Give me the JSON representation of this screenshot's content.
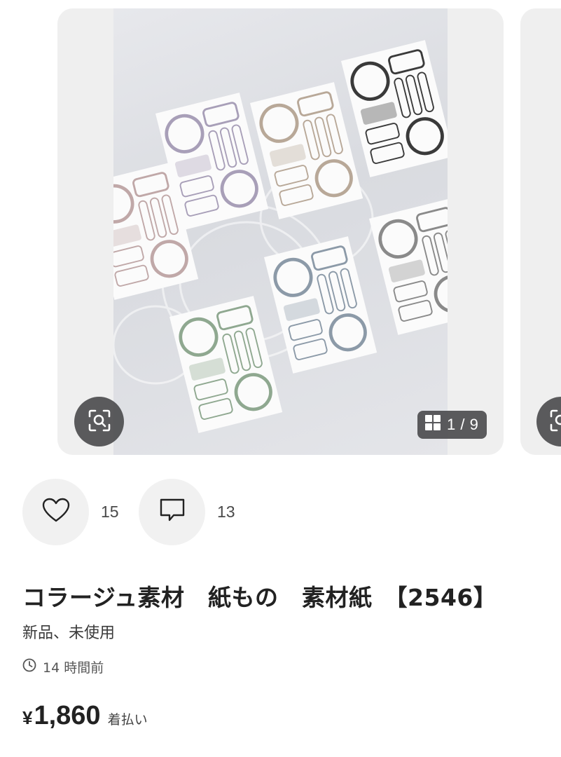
{
  "item": {
    "title": "コラージュ素材　紙もの　素材紙　【2546】",
    "condition": "新品、未使用",
    "posted_ago": "14 時間前",
    "price_currency": "¥",
    "price": "1,860",
    "shipping": "着払い"
  },
  "carousel": {
    "counter": "1 / 9"
  },
  "actions": {
    "likes": "15",
    "comments": "13"
  },
  "icons": {
    "zoom": "zoom-search-icon",
    "grid": "grid-icon",
    "like": "heart-icon",
    "comment": "comment-icon",
    "clock": "clock-icon"
  },
  "colors": {
    "overlay": "#464648",
    "action_bg": "#f1f1f1",
    "text": "#222222"
  }
}
